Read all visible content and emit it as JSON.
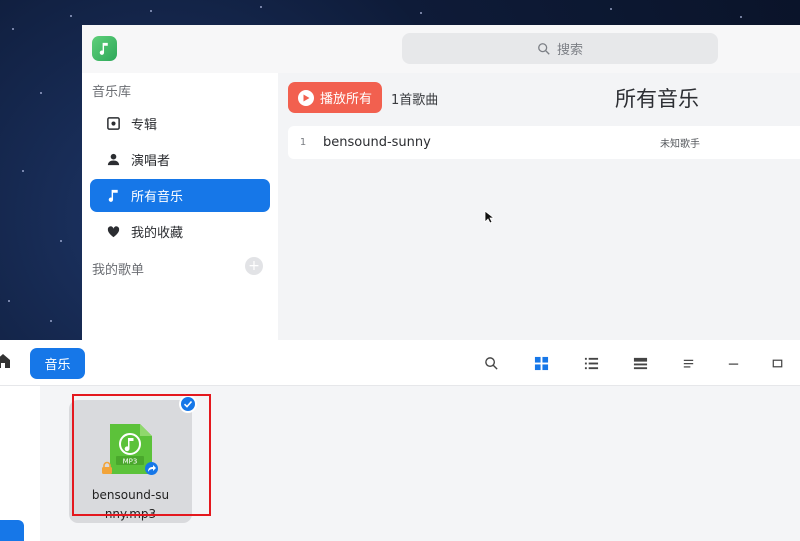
{
  "music": {
    "search_placeholder": "搜索",
    "sidebar": {
      "library_title": "音乐库",
      "items": [
        {
          "label": "专辑",
          "icon": "album-icon"
        },
        {
          "label": "演唱者",
          "icon": "person-icon"
        },
        {
          "label": "所有音乐",
          "icon": "music-note-icon",
          "active": true
        },
        {
          "label": "我的收藏",
          "icon": "heart-icon"
        }
      ],
      "playlists_title": "我的歌单",
      "add_playlist": "+"
    },
    "main": {
      "play_all_label": "播放所有",
      "song_count": "1首歌曲",
      "title": "所有音乐",
      "songs": [
        {
          "index": "1",
          "name": "bensound-sunny",
          "artist": "未知歌手"
        }
      ]
    }
  },
  "file_manager": {
    "breadcrumb": "音乐",
    "files": [
      {
        "name": "bensound-sunny.mp3",
        "badge_text": "MP3",
        "selected": true
      }
    ]
  },
  "colors": {
    "accent": "#1677e8",
    "play_button": "#f2604f",
    "highlight": "#e4181e"
  }
}
